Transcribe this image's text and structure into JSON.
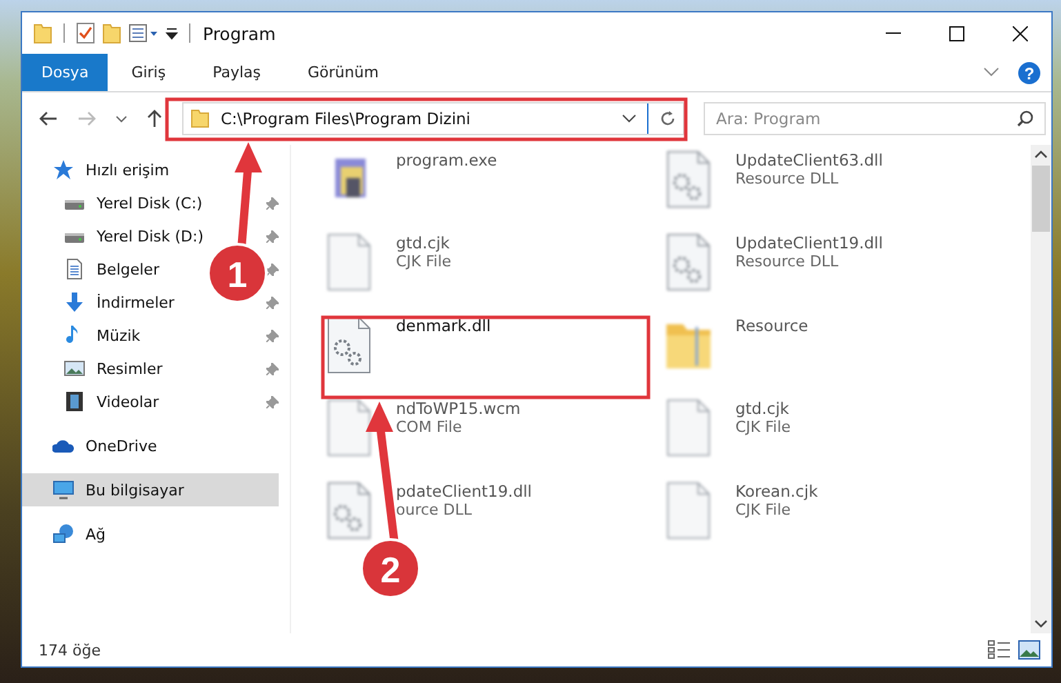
{
  "window": {
    "title": "Program"
  },
  "ribbon_tabs": [
    {
      "label": "Dosya",
      "selected": true
    },
    {
      "label": "Giriş",
      "selected": false
    },
    {
      "label": "Paylaş",
      "selected": false
    },
    {
      "label": "Görünüm",
      "selected": false
    }
  ],
  "help": {
    "label": "?"
  },
  "address_bar": {
    "path": "C:\\Program Files\\Program Dizini"
  },
  "search": {
    "placeholder": "Ara: Program"
  },
  "sidebar": {
    "items": [
      {
        "label": "Hızlı erişim",
        "kind": "star",
        "selected": false,
        "pinned": false,
        "children": [
          {
            "label": "Yerel Disk (C:)",
            "kind": "drive",
            "selected": false,
            "pinned": true
          },
          {
            "label": "Yerel Disk (D:)",
            "kind": "drive",
            "selected": false,
            "pinned": true
          },
          {
            "label": "Belgeler",
            "kind": "document",
            "selected": false,
            "pinned": true
          },
          {
            "label": "İndirmeler",
            "kind": "download",
            "selected": false,
            "pinned": true
          },
          {
            "label": "Müzik",
            "kind": "music",
            "selected": false,
            "pinned": true
          },
          {
            "label": "Resimler",
            "kind": "picture",
            "selected": false,
            "pinned": true
          },
          {
            "label": "Videolar",
            "kind": "video",
            "selected": false,
            "pinned": true
          }
        ]
      },
      {
        "label": "OneDrive",
        "kind": "cloud",
        "selected": false,
        "pinned": false
      },
      {
        "label": "Bu bilgisayar",
        "kind": "computer",
        "selected": true,
        "pinned": false
      },
      {
        "label": "Ağ",
        "kind": "network",
        "selected": false,
        "pinned": false
      }
    ]
  },
  "files": [
    {
      "name": "program.exe",
      "kind": "exe",
      "blurred": true
    },
    {
      "name": "UpdateClient63.dll",
      "type": "Resource DLL",
      "kind": "dll",
      "blurred": true
    },
    {
      "name": "gtd.cjk",
      "type": "CJK File",
      "kind": "blank",
      "blurred": true
    },
    {
      "name": "UpdateClient19.dll",
      "type": "Resource DLL",
      "kind": "dll",
      "blurred": true
    },
    {
      "name": "denmark.dll",
      "kind": "dll",
      "blurred": false
    },
    {
      "name": "Resource",
      "kind": "folder",
      "blurred": true
    },
    {
      "name": "ndToWP15.wcm",
      "type": "COM File",
      "kind": "blank",
      "blurred": true
    },
    {
      "name": "gtd.cjk",
      "type": "CJK File",
      "kind": "blank",
      "blurred": true
    },
    {
      "name": "pdateClient19.dll",
      "type": "ource DLL",
      "kind": "dll",
      "blurred": true
    },
    {
      "name": "Korean.cjk",
      "type": "CJK File",
      "kind": "blank",
      "blurred": true
    }
  ],
  "status_bar": {
    "item_count": "174 öğe"
  },
  "annotations": [
    {
      "label": "1",
      "kind": "address"
    },
    {
      "label": "2",
      "kind": "file"
    }
  ]
}
